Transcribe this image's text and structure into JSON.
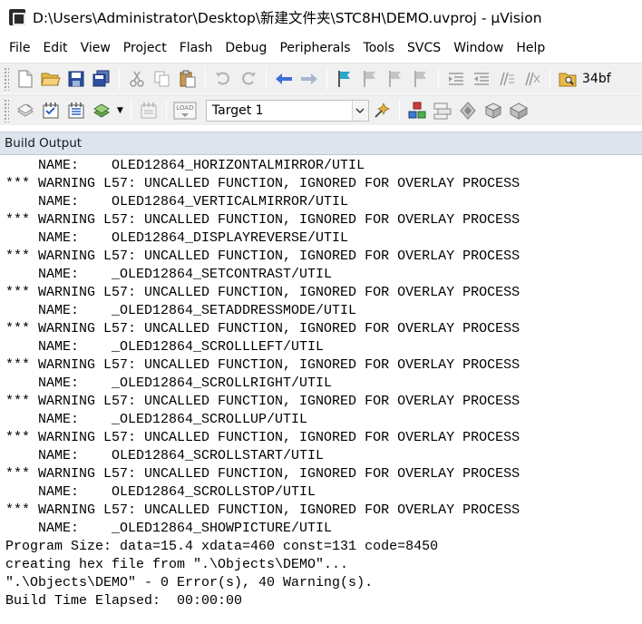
{
  "window": {
    "title": "D:\\Users\\Administrator\\Desktop\\新建文件夹\\STC8H\\DEMO.uvproj - µVision"
  },
  "menu": [
    "File",
    "Edit",
    "View",
    "Project",
    "Flash",
    "Debug",
    "Peripherals",
    "Tools",
    "SVCS",
    "Window",
    "Help"
  ],
  "toolbar1": {
    "icons": [
      "new-file-icon",
      "open-folder-icon",
      "save-icon",
      "save-all-icon",
      "cut-icon",
      "copy-icon",
      "paste-icon",
      "undo-icon",
      "redo-icon",
      "navigate-back-icon",
      "navigate-forward-icon",
      "insert-bookmark-icon",
      "prev-bookmark-icon",
      "next-bookmark-icon",
      "clear-bookmarks-icon",
      "indent-icon",
      "unindent-icon",
      "comment-icon",
      "uncomment-icon",
      "find-in-files-icon"
    ],
    "find_text": "34bf"
  },
  "toolbar2": {
    "target_value": "Target 1",
    "load_label": "LOAD",
    "icons": [
      "translate-icon",
      "build-icon",
      "rebuild-icon",
      "batch-build-icon",
      "download-icon",
      "target-options-icon",
      "manage-components-icon",
      "file-extensions-icon",
      "select-packs-icon",
      "pack-installer-icon"
    ]
  },
  "build_output": {
    "title": "Build Output",
    "lines": [
      "    NAME:    OLED12864_HORIZONTALMIRROR/UTIL",
      "*** WARNING L57: UNCALLED FUNCTION, IGNORED FOR OVERLAY PROCESS",
      "    NAME:    OLED12864_VERTICALMIRROR/UTIL",
      "*** WARNING L57: UNCALLED FUNCTION, IGNORED FOR OVERLAY PROCESS",
      "    NAME:    OLED12864_DISPLAYREVERSE/UTIL",
      "*** WARNING L57: UNCALLED FUNCTION, IGNORED FOR OVERLAY PROCESS",
      "    NAME:    _OLED12864_SETCONTRAST/UTIL",
      "*** WARNING L57: UNCALLED FUNCTION, IGNORED FOR OVERLAY PROCESS",
      "    NAME:    _OLED12864_SETADDRESSMODE/UTIL",
      "*** WARNING L57: UNCALLED FUNCTION, IGNORED FOR OVERLAY PROCESS",
      "    NAME:    _OLED12864_SCROLLLEFT/UTIL",
      "*** WARNING L57: UNCALLED FUNCTION, IGNORED FOR OVERLAY PROCESS",
      "    NAME:    _OLED12864_SCROLLRIGHT/UTIL",
      "*** WARNING L57: UNCALLED FUNCTION, IGNORED FOR OVERLAY PROCESS",
      "    NAME:    _OLED12864_SCROLLUP/UTIL",
      "*** WARNING L57: UNCALLED FUNCTION, IGNORED FOR OVERLAY PROCESS",
      "    NAME:    OLED12864_SCROLLSTART/UTIL",
      "*** WARNING L57: UNCALLED FUNCTION, IGNORED FOR OVERLAY PROCESS",
      "    NAME:    OLED12864_SCROLLSTOP/UTIL",
      "*** WARNING L57: UNCALLED FUNCTION, IGNORED FOR OVERLAY PROCESS",
      "    NAME:    _OLED12864_SHOWPICTURE/UTIL",
      "Program Size: data=15.4 xdata=460 const=131 code=8450",
      "creating hex file from \".\\Objects\\DEMO\"...",
      "\".\\Objects\\DEMO\" - 0 Error(s), 40 Warning(s).",
      "Build Time Elapsed:  00:00:00"
    ]
  },
  "colors": {
    "panel_header_bg": "#dde4ee",
    "toolbar_bg": "#f0f0f0"
  }
}
